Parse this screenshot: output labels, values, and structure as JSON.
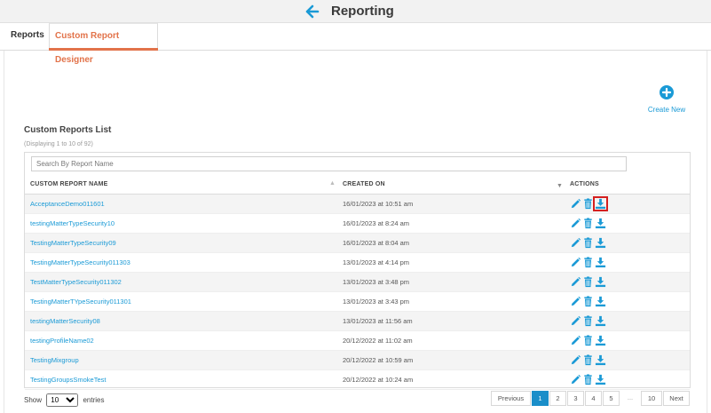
{
  "header": {
    "title": "Reporting",
    "back_icon": "left-arrow-icon"
  },
  "tabs": [
    {
      "label": "Reports",
      "active": false
    },
    {
      "label": "Custom Report Designer",
      "active": true
    }
  ],
  "create_new": {
    "label": "Create New",
    "icon": "plus-circle-icon"
  },
  "list": {
    "title": "Custom Reports List",
    "display_info": "(Displaying 1 to 10 of 92)",
    "search_placeholder": "Search By Report Name",
    "columns": [
      "CUSTOM REPORT NAME",
      "CREATED ON",
      "ACTIONS"
    ],
    "rows": [
      {
        "name": "AcceptanceDemo011601",
        "created": "16/01/2023 at 10:51 am"
      },
      {
        "name": "testingMatterTypeSecurity10",
        "created": "16/01/2023 at 8:24 am"
      },
      {
        "name": "TestingMatterTypeSecurity09",
        "created": "16/01/2023 at 8:04 am"
      },
      {
        "name": "TestingMatterTypeSecurity011303",
        "created": "13/01/2023 at 4:14 pm"
      },
      {
        "name": "TestMatterTypeSecurity011302",
        "created": "13/01/2023 at 3:48 pm"
      },
      {
        "name": "TestingMatterTYpeSecurity011301",
        "created": "13/01/2023 at 3:43 pm"
      },
      {
        "name": "testingMatterSecurity08",
        "created": "13/01/2023 at 11:56 am"
      },
      {
        "name": "testingProfileName02",
        "created": "20/12/2022 at 11:02 am"
      },
      {
        "name": "TestingMixgroup",
        "created": "20/12/2022 at 10:59 am"
      },
      {
        "name": "TestingGroupsSmokeTest",
        "created": "20/12/2022 at 10:24 am"
      }
    ]
  },
  "footer": {
    "show_label": "Show",
    "entries_value": "10",
    "entries_label": "entries",
    "pagination": {
      "previous": "Previous",
      "pages": [
        "1",
        "2",
        "3",
        "4",
        "5"
      ],
      "ellipsis": "...",
      "last": "10",
      "next": "Next",
      "current": "1"
    }
  },
  "colors": {
    "accent": "#1a9ad6",
    "active_tab": "#e2734a",
    "highlight": "#d42020",
    "active_page": "#1a8ec9"
  }
}
